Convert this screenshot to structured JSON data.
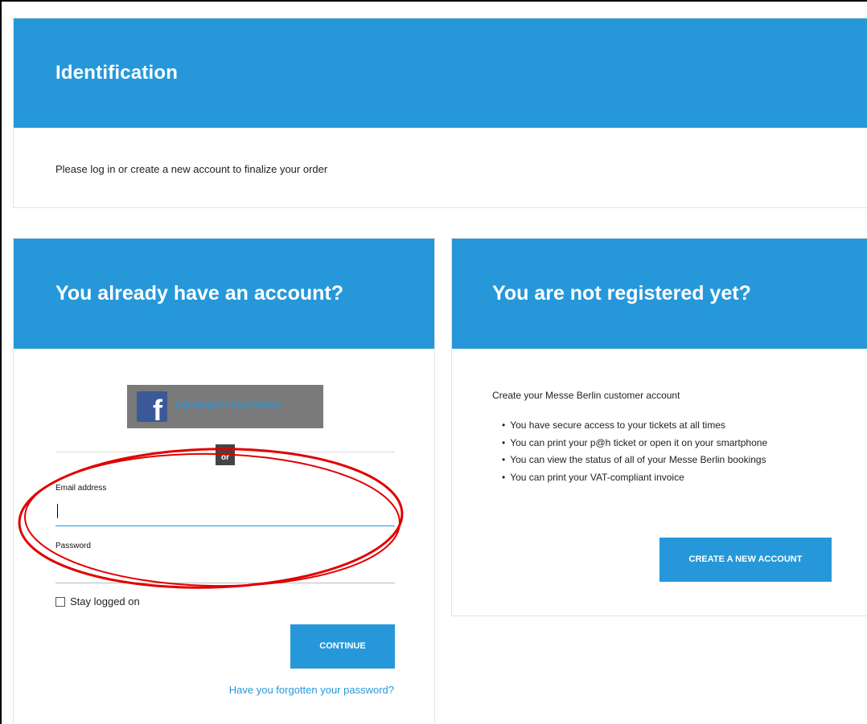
{
  "page": {
    "title": "Identification",
    "intro": "Please log in or create a new account to finalize your order"
  },
  "login": {
    "title": "You already have an account?",
    "facebook_button": "LOGIN WITH FACEBOOK",
    "facebook_icon": "facebook-f-icon",
    "or_label": "or",
    "email_label": "Email address",
    "email_value": "",
    "password_label": "Password",
    "password_value": "",
    "stay_logged_label": "Stay logged on",
    "stay_logged_checked": false,
    "continue_button": "CONTINUE",
    "forgot_link": "Have you forgotten your password?"
  },
  "register": {
    "title": "You are not registered yet?",
    "intro": "Create your Messe Berlin customer account",
    "benefits": [
      "You have secure access to your tickets at all times",
      "You can print your p@h ticket or open it on your smartphone",
      "You can view the status of all of your Messe Berlin bookings",
      "You can print your VAT-compliant invoice"
    ],
    "create_button": "CREATE A NEW ACCOUNT"
  },
  "colors": {
    "accent": "#2698d9",
    "facebook_blue": "#3b5998",
    "facebook_button_bg": "#7a7a7a",
    "annotation_red": "#e00000"
  }
}
